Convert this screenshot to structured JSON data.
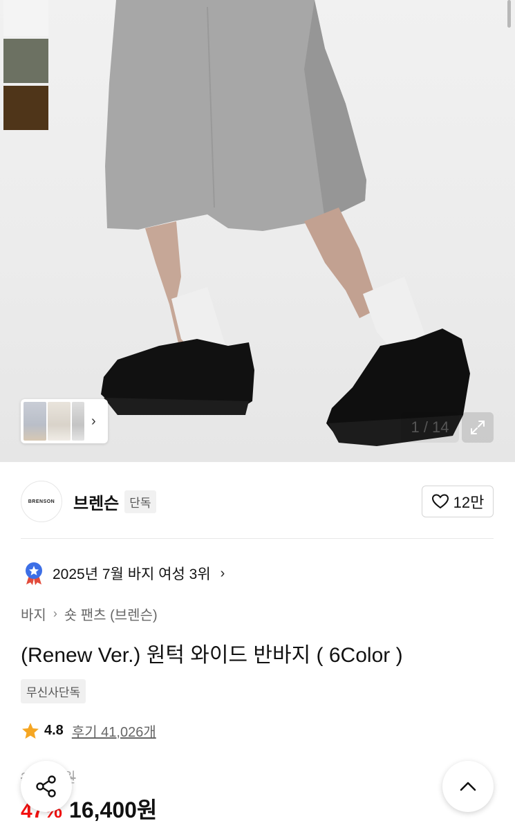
{
  "gallery": {
    "page_counter": "1 / 14",
    "colors": {
      "swatch_white": "#f4f4f4",
      "swatch_olive": "#6c7162",
      "swatch_brown": "#4f3519"
    }
  },
  "brand": {
    "logo_text": "BRENSON",
    "name": "브렌슨",
    "tag": "단독",
    "likes": "12만"
  },
  "ranking": {
    "text": "2025년 7월 바지 여성 3위"
  },
  "breadcrumb": {
    "category": "바지",
    "subcategory": "숏 팬츠 (브렌슨)"
  },
  "product": {
    "title": "(Renew Ver.) 원턱 와이드 반바지 ( 6Color )",
    "badge": "무신사단독",
    "rating": "4.8",
    "reviews": "후기 41,026개",
    "original_price": "30,800원",
    "discount": "47%",
    "price": "16,400원",
    "colors": {
      "discount": "#f31110",
      "star": "#f5a623"
    }
  }
}
